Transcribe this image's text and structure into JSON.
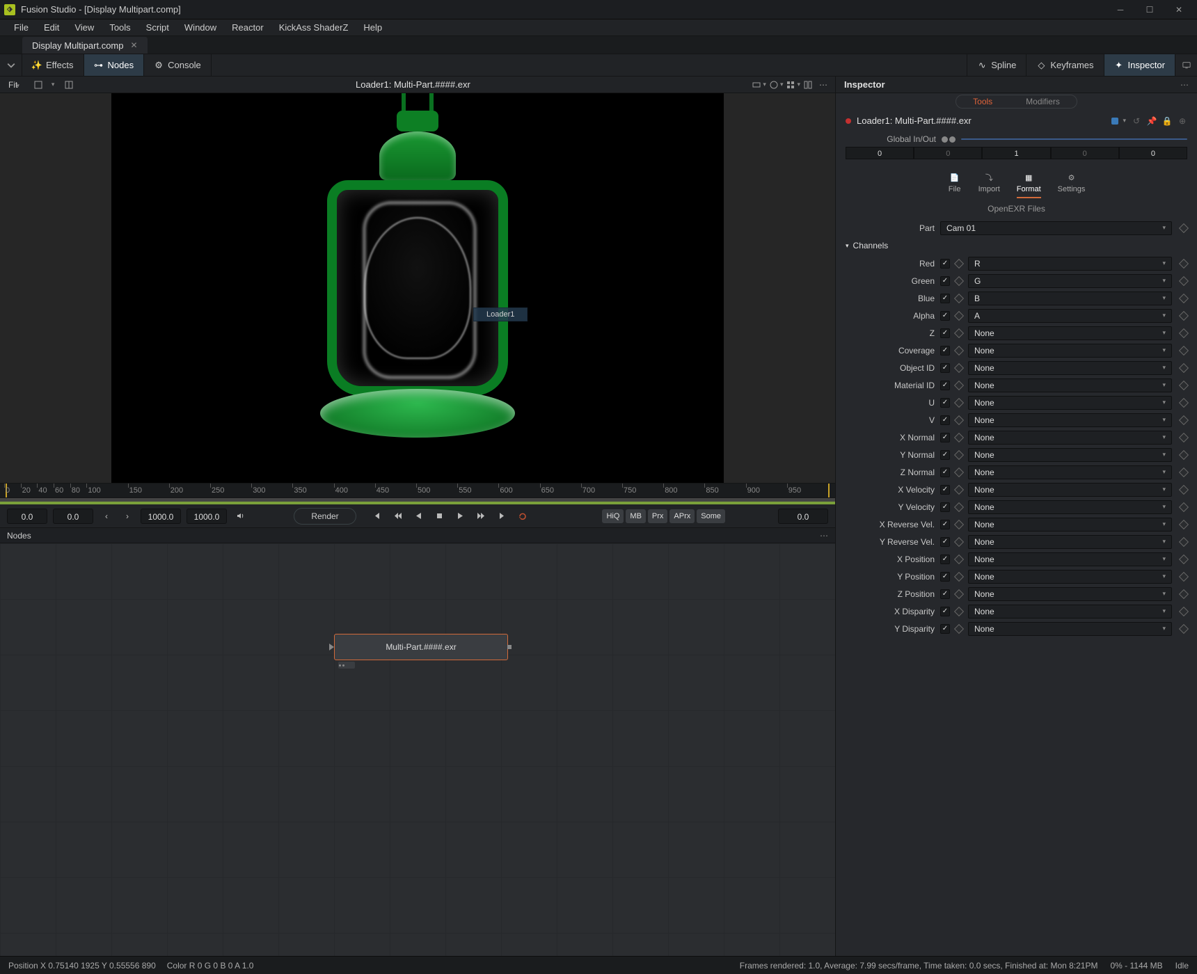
{
  "window": {
    "title": "Fusion Studio - [Display Multipart.comp]"
  },
  "menus": [
    "File",
    "Edit",
    "View",
    "Tools",
    "Script",
    "Window",
    "Reactor",
    "KickAss ShaderZ",
    "Help"
  ],
  "docTab": {
    "name": "Display Multipart.comp"
  },
  "toolbar": {
    "effects": "Effects",
    "nodes": "Nodes",
    "console": "Console",
    "spline": "Spline",
    "keyframes": "Keyframes",
    "inspector": "Inspector"
  },
  "viewer": {
    "fit": "Fit",
    "title": "Loader1: Multi-Part.####.exr",
    "tooltip": "Loader1"
  },
  "ruler": {
    "ticks": [
      0,
      20,
      40,
      60,
      80,
      100,
      150,
      200,
      250,
      300,
      350,
      400,
      450,
      500,
      550,
      600,
      650,
      700,
      750,
      800,
      850,
      900,
      950
    ]
  },
  "transport": {
    "start": "0.0",
    "cur": "0.0",
    "end1": "1000.0",
    "end2": "1000.0",
    "render": "Render",
    "tags": [
      "HiQ",
      "MB",
      "Prx",
      "APrx",
      "Some"
    ],
    "last": "0.0"
  },
  "nodesPanel": {
    "title": "Nodes",
    "nodeLabel": "Multi-Part.####.exr"
  },
  "inspector": {
    "title": "Inspector",
    "tabs": {
      "tools": "Tools",
      "modifiers": "Modifiers"
    },
    "nodeName": "Loader1: Multi-Part.####.exr",
    "globalLabel": "Global In/Out",
    "globals": [
      "0",
      "0",
      "1",
      "0",
      "0"
    ],
    "propTabs": {
      "file": "File",
      "import": "Import",
      "format": "Format",
      "settings": "Settings"
    },
    "openexr": "OpenEXR Files",
    "partLabel": "Part",
    "partValue": "Cam 01",
    "channelsLabel": "Channels",
    "channels": [
      {
        "label": "Red",
        "value": "R"
      },
      {
        "label": "Green",
        "value": "G"
      },
      {
        "label": "Blue",
        "value": "B"
      },
      {
        "label": "Alpha",
        "value": "A"
      },
      {
        "label": "Z",
        "value": "None"
      },
      {
        "label": "Coverage",
        "value": "None"
      },
      {
        "label": "Object ID",
        "value": "None"
      },
      {
        "label": "Material ID",
        "value": "None"
      },
      {
        "label": "U",
        "value": "None"
      },
      {
        "label": "V",
        "value": "None"
      },
      {
        "label": "X Normal",
        "value": "None"
      },
      {
        "label": "Y Normal",
        "value": "None"
      },
      {
        "label": "Z Normal",
        "value": "None"
      },
      {
        "label": "X Velocity",
        "value": "None"
      },
      {
        "label": "Y Velocity",
        "value": "None"
      },
      {
        "label": "X Reverse Vel.",
        "value": "None"
      },
      {
        "label": "Y Reverse Vel.",
        "value": "None"
      },
      {
        "label": "X Position",
        "value": "None"
      },
      {
        "label": "Y Position",
        "value": "None"
      },
      {
        "label": "Z Position",
        "value": "None"
      },
      {
        "label": "X Disparity",
        "value": "None"
      },
      {
        "label": "Y Disparity",
        "value": "None"
      }
    ]
  },
  "status": {
    "pos": "Position   X  0.75140      1925     Y  0.55556      890",
    "color": "Color   R  0               G  0               B  0               A  1.0",
    "render": "Frames rendered: 1.0,   Average: 7.99 secs/frame,   Time taken: 0.0 secs,   Finished at: Mon 8:21PM",
    "mem": "0% - 1144 MB",
    "idle": "Idle"
  }
}
